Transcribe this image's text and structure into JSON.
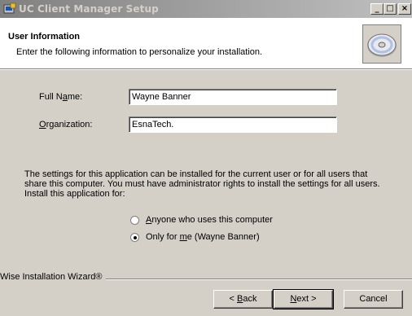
{
  "window": {
    "title": "UC Client Manager Setup",
    "controls": {
      "minimize": "_",
      "maximize": "□",
      "close": "×"
    }
  },
  "header": {
    "title": "User Information",
    "subtitle": "Enter the following information to personalize your installation."
  },
  "form": {
    "full_name": {
      "label_pre": "Full N",
      "label_ul": "a",
      "label_post": "me:",
      "value": "Wayne Banner"
    },
    "organization": {
      "label_pre": "",
      "label_ul": "O",
      "label_post": "rganization:",
      "value": "EsnaTech."
    }
  },
  "install_for": {
    "description": "The settings for this application can be installed for the current user or for all users that share this computer. You must have administrator rights to install the settings for all users. Install this application for:",
    "options": [
      {
        "pre": "",
        "ul": "A",
        "post": "nyone who uses this computer",
        "selected": false
      },
      {
        "pre": "Only for ",
        "ul": "m",
        "post": "e (Wayne Banner)",
        "selected": true
      }
    ]
  },
  "footer": {
    "brand": "Wise Installation Wizard®",
    "buttons": {
      "back": {
        "pre": "< ",
        "ul": "B",
        "post": "ack"
      },
      "next": {
        "pre": "",
        "ul": "N",
        "post": "ext >"
      },
      "cancel": "Cancel"
    }
  },
  "colors": {
    "titlebar_start": "#808080",
    "dialog_bg": "#d4d0c8",
    "header_bg": "#ffffff"
  },
  "icons": [
    "installer-app-icon",
    "cd-disc-icon"
  ]
}
